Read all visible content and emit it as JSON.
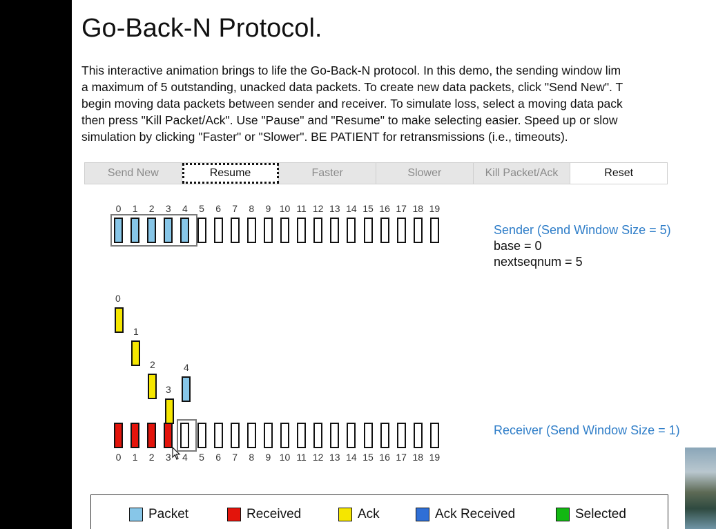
{
  "page": {
    "title": "Go-Back-N Protocol.",
    "intro_lines": [
      "This interactive animation brings to life the Go-Back-N protocol. In this demo, the sending window lim",
      "a maximum of 5 outstanding, unacked data packets. To create new data packets, click \"Send New\". T",
      "begin moving data packets between sender and receiver. To simulate loss, select a moving data pack",
      "then press \"Kill Packet/Ack\". Use \"Pause\" and \"Resume\" to make selecting easier. Speed up or slow",
      "simulation by clicking \"Faster\" or \"Slower\". BE PATIENT for retransmissions (i.e., timeouts)."
    ]
  },
  "toolbar": {
    "send_new": "Send New",
    "resume": "Resume",
    "faster": "Faster",
    "slower": "Slower",
    "kill": "Kill Packet/Ack",
    "reset": "Reset"
  },
  "sender": {
    "header": "Sender (Send Window Size = 5)",
    "base_line": "base = 0",
    "nextseq_line": "nextseqnum = 5",
    "seq_numbers": [
      "0",
      "1",
      "2",
      "3",
      "4",
      "5",
      "6",
      "7",
      "8",
      "9",
      "10",
      "11",
      "12",
      "13",
      "14",
      "15",
      "16",
      "17",
      "18",
      "19"
    ],
    "packet_states": [
      "packet",
      "packet",
      "packet",
      "packet",
      "packet",
      "empty",
      "empty",
      "empty",
      "empty",
      "empty",
      "empty",
      "empty",
      "empty",
      "empty",
      "empty",
      "empty",
      "empty",
      "empty",
      "empty",
      "empty"
    ]
  },
  "receiver": {
    "header": "Receiver (Send Window Size = 1)",
    "seq_numbers": [
      "0",
      "1",
      "2",
      "3",
      "4",
      "5",
      "6",
      "7",
      "8",
      "9",
      "10",
      "11",
      "12",
      "13",
      "14",
      "15",
      "16",
      "17",
      "18",
      "19"
    ],
    "packet_states": [
      "received",
      "received",
      "received",
      "received",
      "empty",
      "empty",
      "empty",
      "empty",
      "empty",
      "empty",
      "empty",
      "empty",
      "empty",
      "empty",
      "empty",
      "empty",
      "empty",
      "empty",
      "empty",
      "empty"
    ]
  },
  "in_flight": [
    {
      "label": "0",
      "kind": "ack"
    },
    {
      "label": "1",
      "kind": "ack"
    },
    {
      "label": "2",
      "kind": "ack"
    },
    {
      "label": "3",
      "kind": "ack"
    },
    {
      "label": "4",
      "kind": "packet"
    }
  ],
  "legend": {
    "packet": "Packet",
    "received": "Received",
    "ack": "Ack",
    "ack_received": "Ack Received",
    "selected": "Selected"
  },
  "colors": {
    "packet": "#87c6e8",
    "received": "#e3140b",
    "ack": "#f5e600",
    "ack_received": "#2f6fd6",
    "selected": "#12b812",
    "header_blue": "#2e7dc8"
  },
  "icons": {
    "cursor": "mouse-pointer-icon"
  }
}
